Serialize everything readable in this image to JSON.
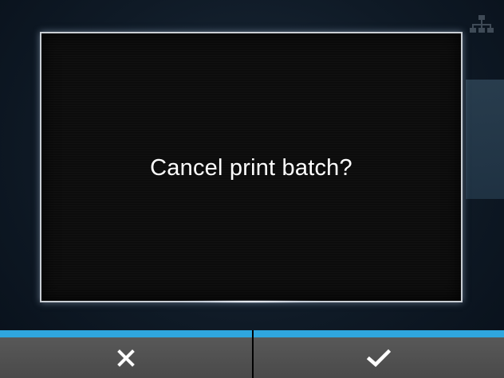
{
  "dialog": {
    "message": "Cancel print batch?"
  },
  "softkeys": {
    "cancel_icon": "close-icon",
    "confirm_icon": "checkmark-icon"
  },
  "colors": {
    "softkey_accent": "#2fa6de",
    "softkey_background": "#4e4e4e",
    "dialog_border": "#c9ced4",
    "message_text": "#ffffff"
  }
}
